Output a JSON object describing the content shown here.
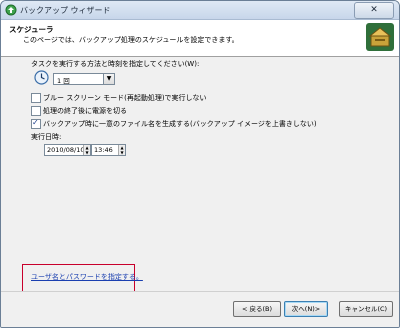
{
  "window": {
    "title": "バックアップ ウィザード",
    "close_glyph": "✕"
  },
  "header": {
    "title": "スケジューラ",
    "subtitle": "このページでは、バックアップ処理のスケジュールを設定できます。"
  },
  "main": {
    "prompt": "タスクを実行する方法と時刻を指定してください(W):",
    "frequency": {
      "value": "1 回",
      "dropdown_glyph": "▼"
    },
    "options": [
      {
        "label": "ブルー スクリーン モード(再起動処理)で実行しない",
        "checked": false
      },
      {
        "label": "処理の終了後に電源を切る",
        "checked": false
      },
      {
        "label": "バックアップ時に一意のファイル名を生成する(バックアップ イメージを上書きしない)",
        "checked": true
      }
    ],
    "run_datetime_label": "実行日時:",
    "date_value": "2010/08/10",
    "time_value": "13:46",
    "credentials_link": "ユーザ名とパスワードを指定する。"
  },
  "footer": {
    "back": "< 戻る(B)",
    "next": "次へ(N)>",
    "cancel": "キャンセル(C)"
  }
}
